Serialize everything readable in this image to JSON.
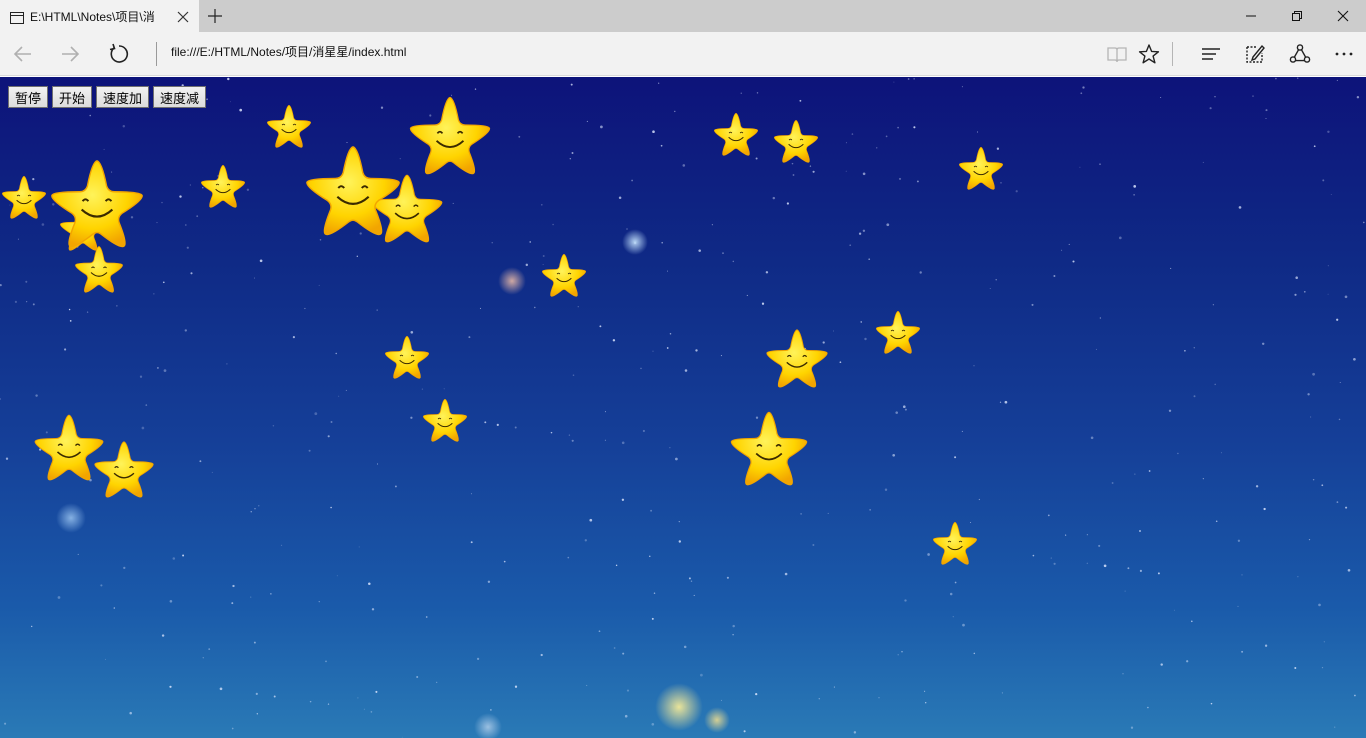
{
  "browser": {
    "tab_title": "E:\\HTML\\Notes\\项目\\消",
    "address": "file:///E:/HTML/Notes/项目/消星星/index.html",
    "icons": {
      "tab": "page-icon",
      "close_tab": "close-icon",
      "new_tab": "plus-icon",
      "minimize": "minimize-icon",
      "restore": "restore-icon",
      "close_window": "close-icon",
      "back": "arrow-left-icon",
      "forward": "arrow-right-icon",
      "refresh": "refresh-icon",
      "reading_view": "book-icon",
      "favorite": "star-outline-icon",
      "hub": "hub-lines-icon",
      "web_note": "pen-note-icon",
      "share": "share-icon",
      "more": "more-dots-icon"
    }
  },
  "controls": {
    "pause_label": "暂停",
    "start_label": "开始",
    "speed_up_label": "速度加",
    "speed_down_label": "速度减"
  },
  "stars": {
    "count": 21,
    "color": "#ffd400",
    "edge_color": "#f2a500",
    "face_color": "#3a2a00"
  },
  "colors": {
    "sky_top": "#0d137a",
    "sky_bottom": "#2a7ab6",
    "chrome": "#f2f2f2",
    "tabbar": "#cccccc"
  }
}
